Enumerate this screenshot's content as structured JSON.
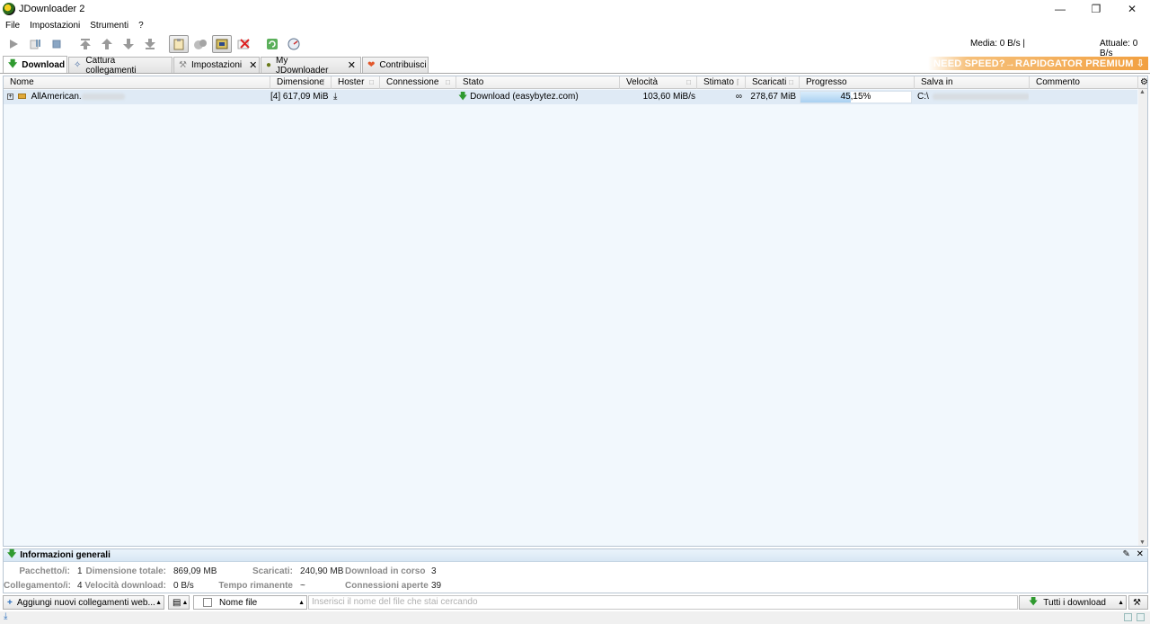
{
  "window": {
    "title": "JDownloader 2"
  },
  "menu": [
    "File",
    "Impostazioni",
    "Strumenti",
    "?"
  ],
  "speed": {
    "average": "Media: 0 B/s |",
    "current": "Attuale: 0 B/s"
  },
  "tabs": [
    {
      "label": "Download",
      "active": true,
      "closable": false
    },
    {
      "label": "Cattura collegamenti",
      "active": false,
      "closable": false
    },
    {
      "label": "Impostazioni",
      "active": false,
      "closable": true
    },
    {
      "label": "My JDownloader",
      "active": false,
      "closable": true
    },
    {
      "label": "Contribuisci",
      "active": false,
      "closable": false
    }
  ],
  "promo": "NEED SPEED?→RAPIDGATOR PREMIUM",
  "columns": [
    "Nome",
    "Dimensione",
    "Hoster",
    "Connessione",
    "Stato",
    "Velocità",
    "Stimato",
    "Scaricati",
    "Progresso",
    "Salva in",
    "Commento"
  ],
  "row": {
    "name": "AllAmerican.",
    "size": "[4]  617,09 MiB",
    "status": "Download (easybytez.com)",
    "speed": "103,60 MiB/s",
    "eta": "∞",
    "downloaded": "278,67 MiB",
    "progress_text": "45,15%",
    "progress": 45.15,
    "save_in": "C:\\"
  },
  "info": {
    "title": "Informazioni generali",
    "packages_label": "Pacchetto/i:",
    "packages": "1",
    "total_size_label": "Dimensione totale:",
    "total_size": "869,09 MB",
    "downloaded_label": "Scaricati:",
    "downloaded": "240,90 MB",
    "running_label": "Download in corso",
    "running": "3",
    "links_label": "Collegamento/i:",
    "links": "4",
    "dl_speed_label": "Velocità download:",
    "dl_speed": "0 B/s",
    "remaining_label": "Tempo rimanente",
    "remaining": "~",
    "connections_label": "Connessioni aperte",
    "connections": "39"
  },
  "bottom": {
    "add_links": "Aggiungi nuovi collegamenti web...",
    "filter": "Nome file",
    "search_placeholder": "Inserisci il nome del file che stai cercando",
    "view": "Tutti i download"
  }
}
